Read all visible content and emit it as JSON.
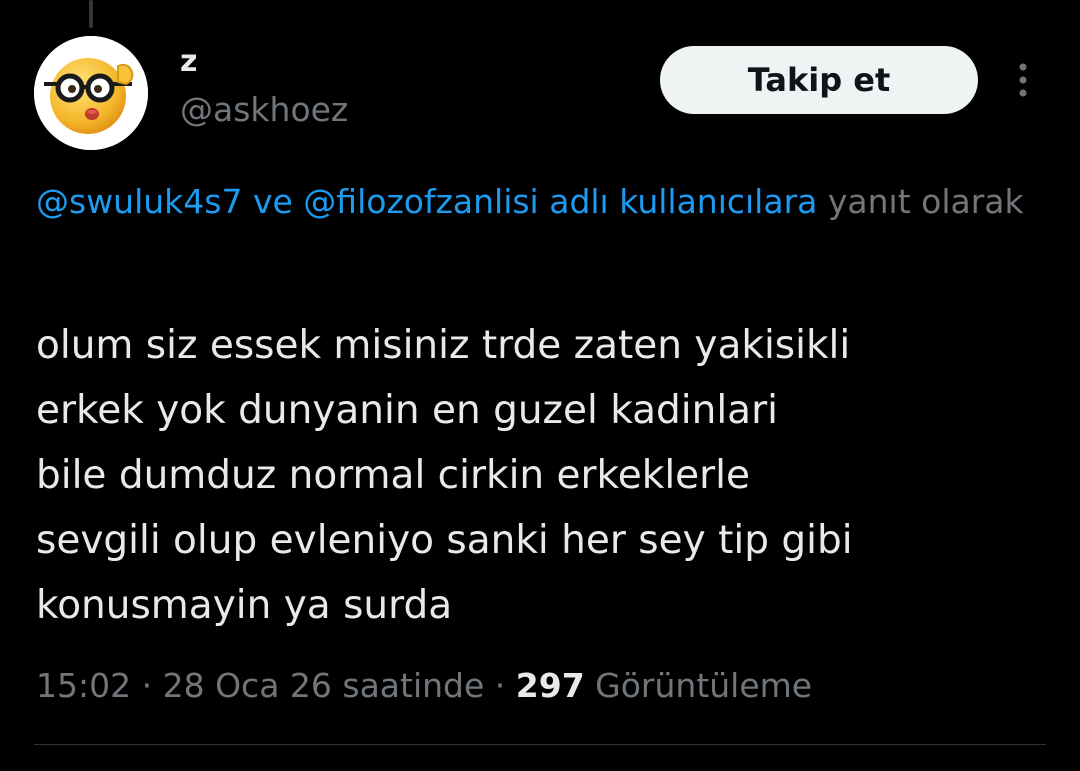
{
  "author": {
    "display_name": "z",
    "handle": "@askhoez"
  },
  "follow_button": {
    "label": "Takip et"
  },
  "more_icon": "more-vertical-icon",
  "reply_context": {
    "mention_1": "@swuluk4s7",
    "connector": " ve ",
    "mention_2": "@filozofzanlisi",
    "suffix_link": " adlı kullanıcılara",
    "suffix_text": " yanıt olarak"
  },
  "tweet": {
    "lines": [
      "olum siz essek misiniz trde zaten yakisikli",
      "erkek yok dunyanin en guzel kadinlari",
      "bile dumduz normal cirkin erkeklerle",
      "sevgili olup evleniyo sanki her sey tip gibi",
      "konusmayin ya surda"
    ]
  },
  "meta": {
    "time": "15:02",
    "separator_1": " · ",
    "date": "28 Oca 26 saatinde",
    "separator_2": " · ",
    "views_count": "297",
    "views_label": " Görüntüleme"
  },
  "colors": {
    "background": "#000000",
    "text_primary": "#e7e9ea",
    "text_secondary": "#71767b",
    "link": "#1d9bf0",
    "button_bg": "#eff3f4"
  }
}
